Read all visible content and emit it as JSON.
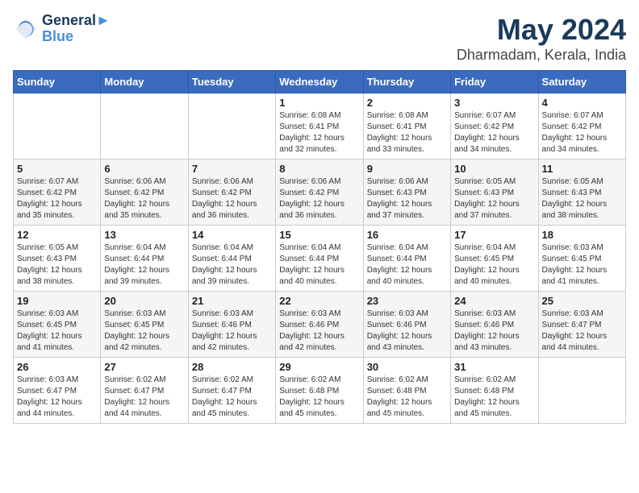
{
  "header": {
    "logo_line1": "General",
    "logo_line2": "Blue",
    "title": "May 2024",
    "subtitle": "Dharmadam, Kerala, India"
  },
  "weekdays": [
    "Sunday",
    "Monday",
    "Tuesday",
    "Wednesday",
    "Thursday",
    "Friday",
    "Saturday"
  ],
  "weeks": [
    [
      {
        "day": "",
        "info": ""
      },
      {
        "day": "",
        "info": ""
      },
      {
        "day": "",
        "info": ""
      },
      {
        "day": "1",
        "info": "Sunrise: 6:08 AM\nSunset: 6:41 PM\nDaylight: 12 hours\nand 32 minutes."
      },
      {
        "day": "2",
        "info": "Sunrise: 6:08 AM\nSunset: 6:41 PM\nDaylight: 12 hours\nand 33 minutes."
      },
      {
        "day": "3",
        "info": "Sunrise: 6:07 AM\nSunset: 6:42 PM\nDaylight: 12 hours\nand 34 minutes."
      },
      {
        "day": "4",
        "info": "Sunrise: 6:07 AM\nSunset: 6:42 PM\nDaylight: 12 hours\nand 34 minutes."
      }
    ],
    [
      {
        "day": "5",
        "info": "Sunrise: 6:07 AM\nSunset: 6:42 PM\nDaylight: 12 hours\nand 35 minutes."
      },
      {
        "day": "6",
        "info": "Sunrise: 6:06 AM\nSunset: 6:42 PM\nDaylight: 12 hours\nand 35 minutes."
      },
      {
        "day": "7",
        "info": "Sunrise: 6:06 AM\nSunset: 6:42 PM\nDaylight: 12 hours\nand 36 minutes."
      },
      {
        "day": "8",
        "info": "Sunrise: 6:06 AM\nSunset: 6:42 PM\nDaylight: 12 hours\nand 36 minutes."
      },
      {
        "day": "9",
        "info": "Sunrise: 6:06 AM\nSunset: 6:43 PM\nDaylight: 12 hours\nand 37 minutes."
      },
      {
        "day": "10",
        "info": "Sunrise: 6:05 AM\nSunset: 6:43 PM\nDaylight: 12 hours\nand 37 minutes."
      },
      {
        "day": "11",
        "info": "Sunrise: 6:05 AM\nSunset: 6:43 PM\nDaylight: 12 hours\nand 38 minutes."
      }
    ],
    [
      {
        "day": "12",
        "info": "Sunrise: 6:05 AM\nSunset: 6:43 PM\nDaylight: 12 hours\nand 38 minutes."
      },
      {
        "day": "13",
        "info": "Sunrise: 6:04 AM\nSunset: 6:44 PM\nDaylight: 12 hours\nand 39 minutes."
      },
      {
        "day": "14",
        "info": "Sunrise: 6:04 AM\nSunset: 6:44 PM\nDaylight: 12 hours\nand 39 minutes."
      },
      {
        "day": "15",
        "info": "Sunrise: 6:04 AM\nSunset: 6:44 PM\nDaylight: 12 hours\nand 40 minutes."
      },
      {
        "day": "16",
        "info": "Sunrise: 6:04 AM\nSunset: 6:44 PM\nDaylight: 12 hours\nand 40 minutes."
      },
      {
        "day": "17",
        "info": "Sunrise: 6:04 AM\nSunset: 6:45 PM\nDaylight: 12 hours\nand 40 minutes."
      },
      {
        "day": "18",
        "info": "Sunrise: 6:03 AM\nSunset: 6:45 PM\nDaylight: 12 hours\nand 41 minutes."
      }
    ],
    [
      {
        "day": "19",
        "info": "Sunrise: 6:03 AM\nSunset: 6:45 PM\nDaylight: 12 hours\nand 41 minutes."
      },
      {
        "day": "20",
        "info": "Sunrise: 6:03 AM\nSunset: 6:45 PM\nDaylight: 12 hours\nand 42 minutes."
      },
      {
        "day": "21",
        "info": "Sunrise: 6:03 AM\nSunset: 6:46 PM\nDaylight: 12 hours\nand 42 minutes."
      },
      {
        "day": "22",
        "info": "Sunrise: 6:03 AM\nSunset: 6:46 PM\nDaylight: 12 hours\nand 42 minutes."
      },
      {
        "day": "23",
        "info": "Sunrise: 6:03 AM\nSunset: 6:46 PM\nDaylight: 12 hours\nand 43 minutes."
      },
      {
        "day": "24",
        "info": "Sunrise: 6:03 AM\nSunset: 6:46 PM\nDaylight: 12 hours\nand 43 minutes."
      },
      {
        "day": "25",
        "info": "Sunrise: 6:03 AM\nSunset: 6:47 PM\nDaylight: 12 hours\nand 44 minutes."
      }
    ],
    [
      {
        "day": "26",
        "info": "Sunrise: 6:03 AM\nSunset: 6:47 PM\nDaylight: 12 hours\nand 44 minutes."
      },
      {
        "day": "27",
        "info": "Sunrise: 6:02 AM\nSunset: 6:47 PM\nDaylight: 12 hours\nand 44 minutes."
      },
      {
        "day": "28",
        "info": "Sunrise: 6:02 AM\nSunset: 6:47 PM\nDaylight: 12 hours\nand 45 minutes."
      },
      {
        "day": "29",
        "info": "Sunrise: 6:02 AM\nSunset: 6:48 PM\nDaylight: 12 hours\nand 45 minutes."
      },
      {
        "day": "30",
        "info": "Sunrise: 6:02 AM\nSunset: 6:48 PM\nDaylight: 12 hours\nand 45 minutes."
      },
      {
        "day": "31",
        "info": "Sunrise: 6:02 AM\nSunset: 6:48 PM\nDaylight: 12 hours\nand 45 minutes."
      },
      {
        "day": "",
        "info": ""
      }
    ]
  ]
}
